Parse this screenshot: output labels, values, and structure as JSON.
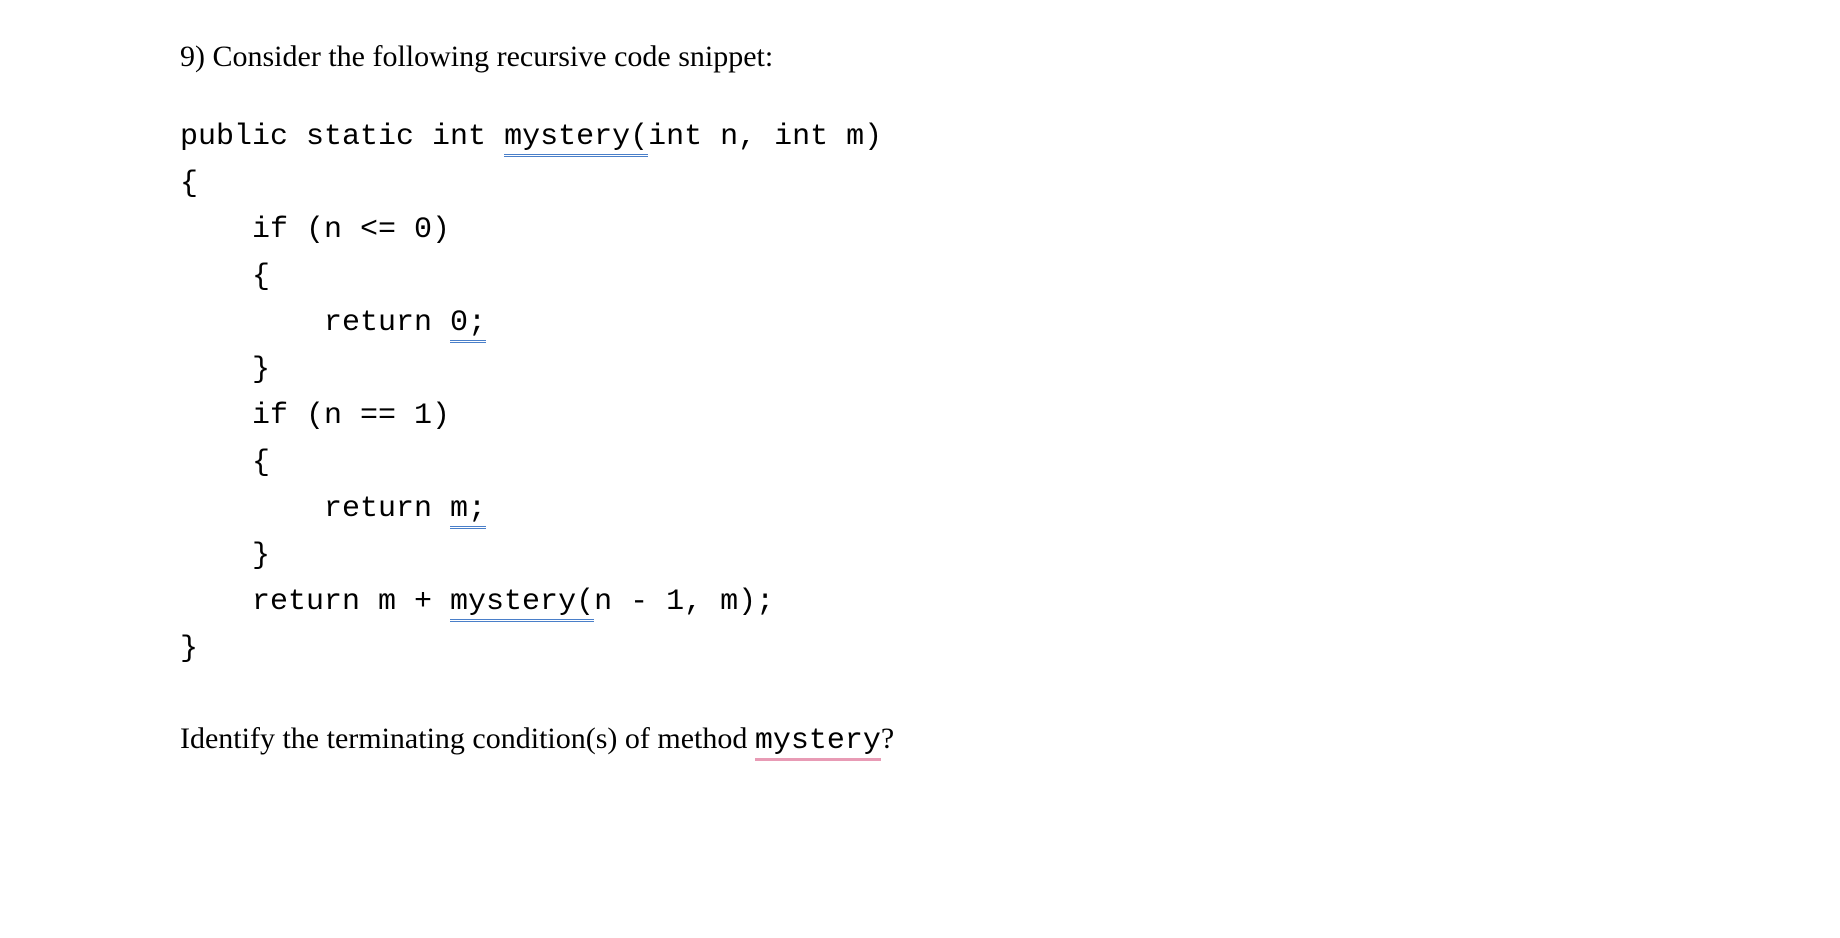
{
  "question": {
    "intro": "9) Consider the following recursive code snippet:",
    "ask_prefix": "Identify the terminating condition(s) of method ",
    "ask_method": "mystery",
    "ask_suffix": "?"
  },
  "code": {
    "line1_prefix": "public static int ",
    "line1_underlined": "mystery(",
    "line1_suffix": "int n, int m)",
    "line2": "{",
    "line3": "    if (n <= 0)",
    "line4": "    {",
    "line5_prefix": "        return ",
    "line5_underlined": "0;",
    "line6": "    }",
    "line7": "    if (n == 1)",
    "line8": "    {",
    "line9_prefix": "        return ",
    "line9_underlined": "m;",
    "line10": "    }",
    "line11_prefix": "    return m + ",
    "line11_underlined": "mystery(",
    "line11_suffix": "n - 1, m);",
    "line12": "}"
  }
}
